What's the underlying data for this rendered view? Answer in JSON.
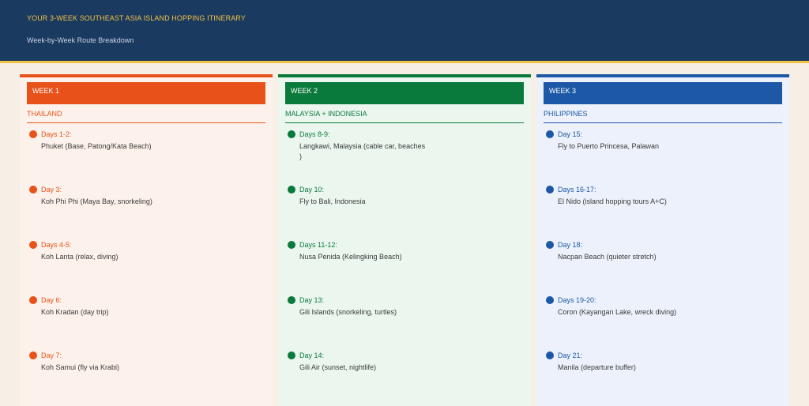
{
  "header": {
    "title": "YOUR 3-WEEK SOUTHEAST ASIA ISLAND HOPPING ITINERARY",
    "subtitle": "Week-by-Week Route Breakdown"
  },
  "colors": {
    "header_bg": "#1b3a60",
    "header_accent": "#f1c244",
    "week1": "#e8521a",
    "week2": "#0a7a3c",
    "week3": "#1c58a6"
  },
  "weeks": [
    {
      "label": "WEEK 1",
      "region": "THAILAND",
      "days": [
        {
          "label": "Days 1-2:",
          "desc": "Phuket (Base, Patong/Kata Beach)"
        },
        {
          "label": "Day 3:",
          "desc": "Koh Phi Phi (Maya Bay, snorkeling)"
        },
        {
          "label": "Days 4-5:",
          "desc": "Koh Lanta (relax, diving)"
        },
        {
          "label": "Day 6:",
          "desc": "Koh Kradan (day trip)"
        },
        {
          "label": "Day 7:",
          "desc": "Koh Samui (fly via Krabi)"
        }
      ]
    },
    {
      "label": "WEEK 2",
      "region": "MALAYSIA + INDONESIA",
      "days": [
        {
          "label": "Days 8-9:",
          "desc": "Langkawi, Malaysia (cable car, beaches )"
        },
        {
          "label": "Day 10:",
          "desc": "Fly to Bali, Indonesia"
        },
        {
          "label": "Days 11-12:",
          "desc": "Nusa Penida (Kelingking Beach)"
        },
        {
          "label": "Day 13:",
          "desc": "Gili Islands (snorkeling, turtles)"
        },
        {
          "label": "Day 14:",
          "desc": "Gili Air (sunset, nightlife)"
        }
      ]
    },
    {
      "label": "WEEK 3",
      "region": "PHILIPPINES",
      "days": [
        {
          "label": "Day 15:",
          "desc": "Fly to Puerto Princesa, Palawan"
        },
        {
          "label": "Days 16-17:",
          "desc": "El Nido (island hopping tours A+C)"
        },
        {
          "label": "Day 18:",
          "desc": "Nacpan Beach (quieter stretch)"
        },
        {
          "label": "Days 19-20:",
          "desc": "Coron (Kayangan Lake, wreck diving)"
        },
        {
          "label": "Day 21:",
          "desc": "Manila (departure buffer)"
        }
      ]
    }
  ]
}
